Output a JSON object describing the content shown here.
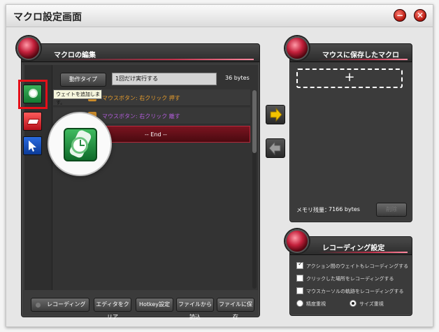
{
  "window": {
    "title": "マクロ設定画面",
    "minimize_label": "−",
    "close_label": "✕"
  },
  "macro_editor": {
    "title": "マクロの編集",
    "action_type_label": "動作タイプ",
    "run_mode_value": "1回だけ実行する",
    "size_text": "36 bytes",
    "tooltip": "ウェイトを追加します。",
    "rows": [
      {
        "text": "マウスボタン:  右クリック   押す",
        "color": "#e39a2c"
      },
      {
        "text": "マウスボタン:  右クリック   離す",
        "color": "#b05cd8"
      },
      {
        "text": "-- End --",
        "color": "#ffffff"
      }
    ],
    "tools": [
      "wait-clock-icon",
      "delete-eraser-icon",
      "cursor-arrow-icon"
    ]
  },
  "buttons": {
    "recording": "レコーディング",
    "clear_editor": "エディタをクリア",
    "hotkey": "Hotkey設定",
    "load_file": "ファイルから読込",
    "save_file": "ファイルに保存"
  },
  "saved_macros": {
    "title": "マウスに保存したマクロ",
    "add_label": "+",
    "memory_label": "メモリ残量：",
    "memory_value": "7166 bytes",
    "delete_label": "削除"
  },
  "recording_settings": {
    "title": "レコーディング設定",
    "options": [
      {
        "label": "アクション間のウェイトもレコーディングする",
        "checked": true
      },
      {
        "label": "クリックした場所をレコーディングする",
        "checked": false
      },
      {
        "label": "マウスカーソルの軌跡をレコーディングする",
        "checked": false
      }
    ],
    "radio_precision": "精度重視",
    "radio_size": "サイズ重視",
    "selected_radio": "サイズ重視"
  },
  "colors": {
    "accent_red": "#c3203b",
    "selection": "#e4101a",
    "arrow_yellow": "#f2c300"
  }
}
